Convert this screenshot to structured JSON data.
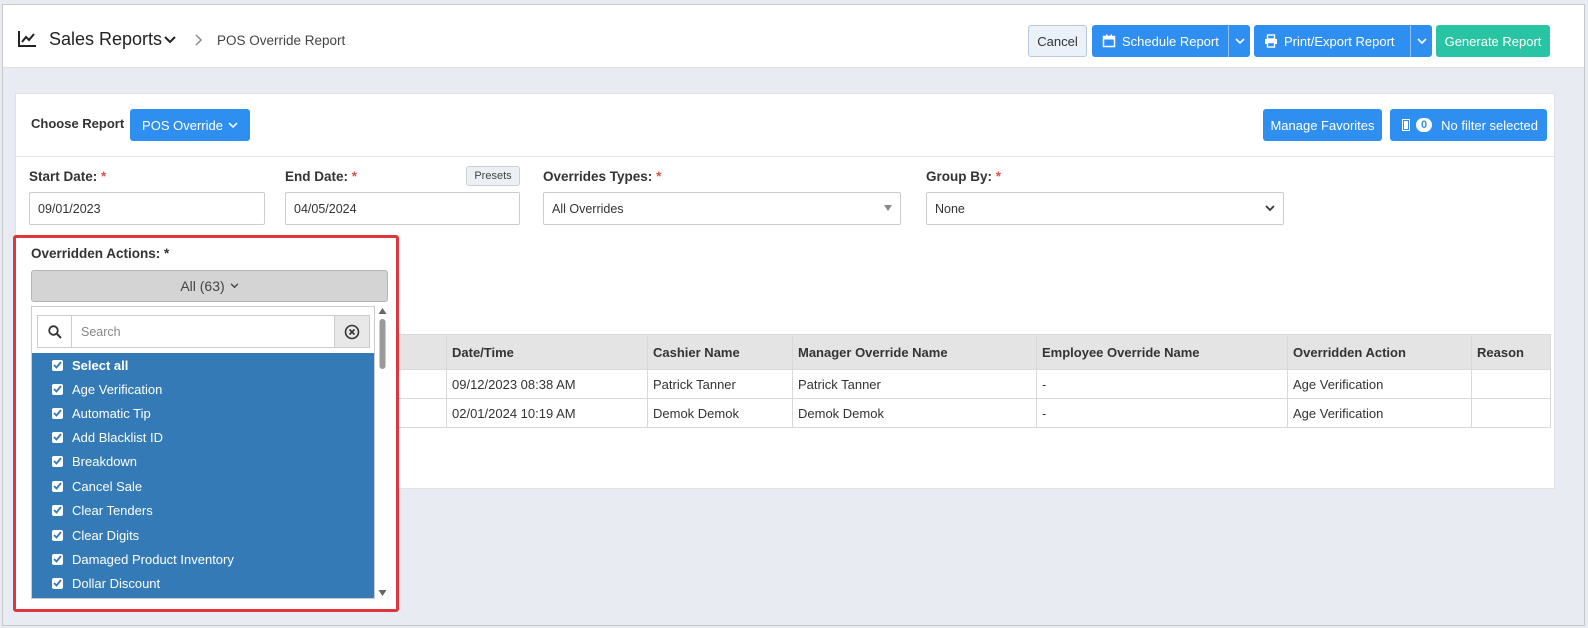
{
  "header": {
    "title": "Sales Reports",
    "breadcrumb": "POS Override Report",
    "buttons": {
      "cancel": "Cancel",
      "schedule": "Schedule Report",
      "print": "Print/Export Report",
      "generate": "Generate Report"
    }
  },
  "toolbar": {
    "choose_report_label": "Choose Report",
    "report_selected": "POS Override",
    "manage_favorites": "Manage Favorites",
    "filter_count": "0",
    "filter_text": "No filter selected"
  },
  "filters": {
    "start_date": {
      "label": "Start Date:",
      "value": "09/01/2023"
    },
    "end_date": {
      "label": "End Date:",
      "value": "04/05/2024",
      "presets": "Presets"
    },
    "overrides_types": {
      "label": "Overrides Types:",
      "value": "All Overrides"
    },
    "group_by": {
      "label": "Group By:",
      "value": "None"
    },
    "required_mark": "*"
  },
  "overridden_actions": {
    "label": "Overridden Actions: *",
    "button": "All (63)",
    "search_placeholder": "Search",
    "items": [
      "Select all",
      "Age Verification",
      "Automatic Tip",
      "Add Blacklist ID",
      "Breakdown",
      "Cancel Sale",
      "Clear Tenders",
      "Clear Digits",
      "Damaged Product Inventory",
      "Dollar Discount"
    ]
  },
  "table": {
    "columns": [
      "Date/Time",
      "Cashier Name",
      "Manager Override Name",
      "Employee Override Name",
      "Overridden Action",
      "Reason"
    ],
    "rows": [
      [
        "09/12/2023 08:38 AM",
        "Patrick Tanner",
        "Patrick Tanner",
        "-",
        "Age Verification",
        ""
      ],
      [
        "02/01/2024 10:19 AM",
        "Demok Demok",
        "Demok Demok",
        "-",
        "Age Verification",
        ""
      ]
    ]
  },
  "colors": {
    "primary": "#2f8ff0",
    "success": "#29c4a3",
    "selected_list": "#337ab7",
    "highlight_border": "#e0353d"
  }
}
